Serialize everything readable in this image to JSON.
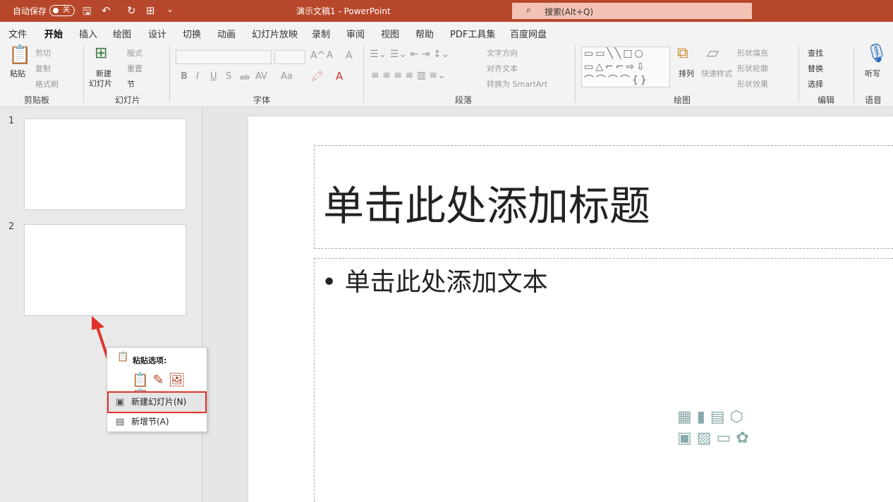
{
  "titlebar": {
    "autosave_label": "自动保存",
    "autosave_state": "关",
    "doc_title": "演示文稿1  -  PowerPoint",
    "search_placeholder": "搜索(Alt+Q)"
  },
  "menu": {
    "tabs": [
      "文件",
      "开始",
      "插入",
      "绘图",
      "设计",
      "切换",
      "动画",
      "幻灯片放映",
      "录制",
      "审阅",
      "视图",
      "帮助",
      "PDF工具集",
      "百度网盘"
    ],
    "active": "开始"
  },
  "ribbon": {
    "clipboard": {
      "paste": "粘贴",
      "cut": "剪切",
      "copy": "复制",
      "format_painter": "格式刷",
      "label": "剪贴板"
    },
    "slides": {
      "new_slide": "新建",
      "new_slide2": "幻灯片",
      "layout": "版式",
      "reset": "重置",
      "section": "节",
      "label": "幻灯片"
    },
    "font": {
      "label": "字体",
      "bold": "B",
      "italic": "I",
      "underline": "U",
      "shadow": "S",
      "strike": "ab",
      "spacing": "AV",
      "case": "Aa",
      "grow": "A^",
      "shrink": "A",
      "clear": "A"
    },
    "paragraph": {
      "label": "段落",
      "text_direction": "文字方向",
      "align_text": "对齐文本",
      "smartart": "转换为 SmartArt"
    },
    "drawing": {
      "label": "绘图",
      "arrange": "排列",
      "quick_styles": "快速样式",
      "shape_fill": "形状填充",
      "shape_outline": "形状轮廓",
      "shape_effects": "形状效果"
    },
    "editing": {
      "label": "编辑",
      "find": "查找",
      "replace": "替换",
      "select": "选择"
    },
    "voice": {
      "label": "语音",
      "dictate": "听写"
    }
  },
  "slides": [
    {
      "number": "1"
    },
    {
      "number": "2"
    }
  ],
  "slide": {
    "title_placeholder": "单击此处添加标题",
    "body_placeholder": "• 单击此处添加文本"
  },
  "context_menu": {
    "paste_header": "粘贴选项:",
    "new_slide": "新建幻灯片(N)",
    "new_section": "新增节(A)"
  },
  "colors": {
    "accent": "#b7472a",
    "highlight_box": "#e0322a"
  }
}
